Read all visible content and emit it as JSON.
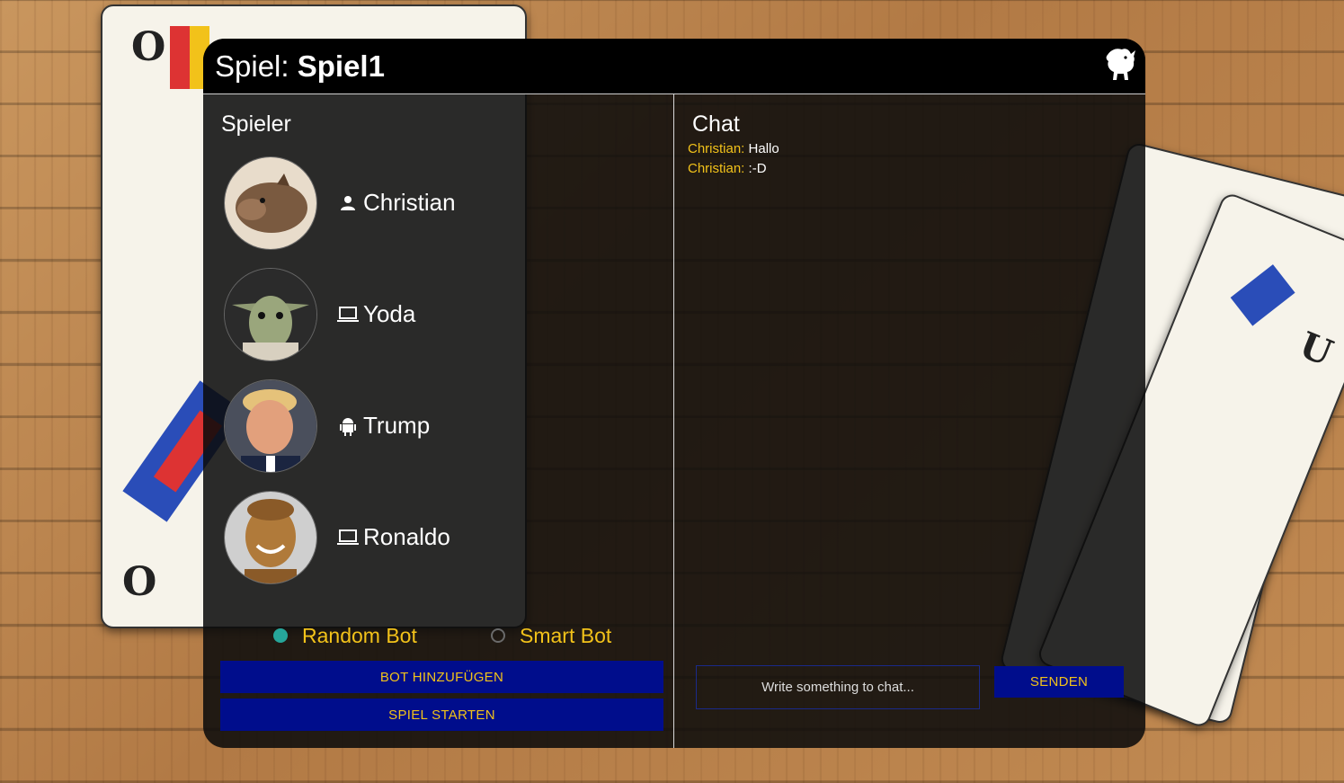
{
  "window": {
    "title_prefix": "Spiel:",
    "title_name": "Spiel1",
    "logo_icon": "boar-icon"
  },
  "players_section": {
    "title": "Spieler",
    "players": [
      {
        "name": "Christian",
        "type_icon": "person-icon"
      },
      {
        "name": "Yoda",
        "type_icon": "laptop-icon"
      },
      {
        "name": "Trump",
        "type_icon": "android-icon"
      },
      {
        "name": "Ronaldo",
        "type_icon": "laptop-icon"
      }
    ]
  },
  "bot_options": {
    "options": [
      {
        "label": "Random Bot",
        "selected": true
      },
      {
        "label": "Smart Bot",
        "selected": false
      }
    ],
    "selected_color": "#26a69a"
  },
  "buttons": {
    "add_bot": "BOT HINZUFÜGEN",
    "start_game": "SPIEL STARTEN"
  },
  "chat": {
    "title": "Chat",
    "messages": [
      {
        "author": "Christian:",
        "text": "Hallo"
      },
      {
        "author": "Christian:",
        "text": ":-D"
      }
    ],
    "input_placeholder": "Write something to chat...",
    "send_label": "SENDEN"
  },
  "colors": {
    "accent": "#f2c21a",
    "button_bg": "#000d8c",
    "header_bg": "#000000"
  }
}
